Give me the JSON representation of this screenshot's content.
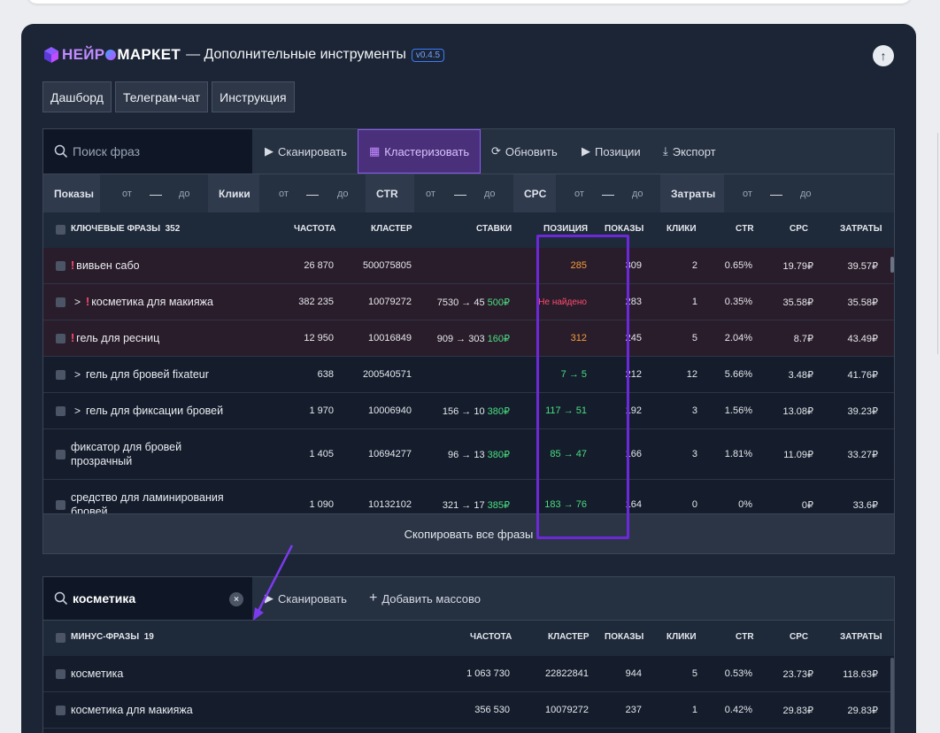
{
  "header": {
    "brand_part1": "НЕЙР",
    "brand_part2": "МАРКЕТ",
    "subtitle": "— Дополнительные инструменты",
    "version": "v0.4.5"
  },
  "nav_tabs": [
    {
      "label": "Дашборд"
    },
    {
      "label": "Телеграм-чат"
    },
    {
      "label": "Инструкция"
    }
  ],
  "toolbar": {
    "search_placeholder": "Поиск фраз",
    "scan": "Сканировать",
    "cluster": "Кластеризовать",
    "refresh": "Обновить",
    "positions": "Позиции",
    "export": "Экспорт"
  },
  "filters": {
    "from": "от",
    "dash": "—",
    "to": "до",
    "labels": [
      "Показы",
      "Клики",
      "CTR",
      "CPC",
      "Затраты"
    ]
  },
  "keywords_table": {
    "title": "КЛЮЧЕВЫЕ ФРАЗЫ",
    "count": "352",
    "columns": [
      "ЧАСТОТА",
      "КЛАСТЕР",
      "СТАВКИ",
      "ПОЗИЦИЯ",
      "ПОКАЗЫ",
      "КЛИКИ",
      "CTR",
      "CPC",
      "ЗАТРАТЫ"
    ],
    "rows": [
      {
        "warn": "!",
        "expand": "",
        "phrase": "вивьен сабо",
        "freq": "26 870",
        "cluster": "500075805",
        "bid": "",
        "bid_price": "",
        "position": "285",
        "impr": "309",
        "clicks": "2",
        "ctr": "0.65%",
        "cpc": "19.79₽",
        "cost": "39.57₽"
      },
      {
        "warn": "!",
        "expand": ">",
        "phrase": "косметика для макияжа",
        "freq": "382 235",
        "cluster": "10079272",
        "bid": "7530 → 45",
        "bid_price": "500₽",
        "position": "Не найдено",
        "impr": "283",
        "clicks": "1",
        "ctr": "0.35%",
        "cpc": "35.58₽",
        "cost": "35.58₽"
      },
      {
        "warn": "!",
        "expand": "",
        "phrase": "гель для ресниц",
        "freq": "12 950",
        "cluster": "10016849",
        "bid": "909 → 303",
        "bid_price": "160₽",
        "position": "312",
        "impr": "245",
        "clicks": "5",
        "ctr": "2.04%",
        "cpc": "8.7₽",
        "cost": "43.49₽"
      },
      {
        "warn": "",
        "expand": ">",
        "phrase": "гель для бровей fixateur",
        "freq": "638",
        "cluster": "200540571",
        "bid": "",
        "bid_price": "",
        "position": "7 → 5",
        "impr": "212",
        "clicks": "12",
        "ctr": "5.66%",
        "cpc": "3.48₽",
        "cost": "41.76₽"
      },
      {
        "warn": "",
        "expand": ">",
        "phrase": "гель для фиксации бровей",
        "freq": "1 970",
        "cluster": "10006940",
        "bid": "156 → 10",
        "bid_price": "380₽",
        "position": "117 → 51",
        "impr": "192",
        "clicks": "3",
        "ctr": "1.56%",
        "cpc": "13.08₽",
        "cost": "39.23₽"
      },
      {
        "warn": "",
        "expand": "",
        "phrase_line1": "фиксатор для бровей",
        "phrase_line2": "прозрачный",
        "freq": "1 405",
        "cluster": "10694277",
        "bid": "96 → 13",
        "bid_price": "380₽",
        "position": "85 → 47",
        "impr": "166",
        "clicks": "3",
        "ctr": "1.81%",
        "cpc": "11.09₽",
        "cost": "33.27₽"
      },
      {
        "warn": "",
        "expand": "",
        "phrase_line1": "средство для ламинирования",
        "phrase_line2": "бровей",
        "freq": "1 090",
        "cluster": "10132102",
        "bid": "321 → 17",
        "bid_price": "385₽",
        "position": "183 → 76",
        "impr": "164",
        "clicks": "0",
        "ctr": "0%",
        "cpc": "0₽",
        "cost": "33.6₽"
      }
    ],
    "copy_all": "Скопировать все фразы"
  },
  "minus_toolbar": {
    "search_value": "косметика",
    "clear": "×",
    "scan": "Сканировать",
    "add_bulk": "Добавить массово"
  },
  "minus_table": {
    "title": "МИНУС-ФРАЗЫ",
    "count": "19",
    "columns": [
      "ЧАСТОТА",
      "КЛАСТЕР",
      "ПОКАЗЫ",
      "КЛИКИ",
      "CTR",
      "CPC",
      "ЗАТРАТЫ"
    ],
    "rows": [
      {
        "phrase": "косметика",
        "freq": "1 063 730",
        "cluster": "22822841",
        "impr": "944",
        "clicks": "5",
        "ctr": "0.53%",
        "cpc": "23.73₽",
        "cost": "118.63₽"
      },
      {
        "phrase": "косметика для макияжа",
        "freq": "356 530",
        "cluster": "10079272",
        "impr": "237",
        "clicks": "1",
        "ctr": "0.42%",
        "cpc": "29.83₽",
        "cost": "29.83₽"
      }
    ]
  },
  "colors": {
    "panel_bg": "#1c2535",
    "accent_purple": "#6d28d9",
    "warn_red": "#ff4d6d",
    "ok_green": "#4ade80",
    "position_orange": "#f59e3b"
  }
}
